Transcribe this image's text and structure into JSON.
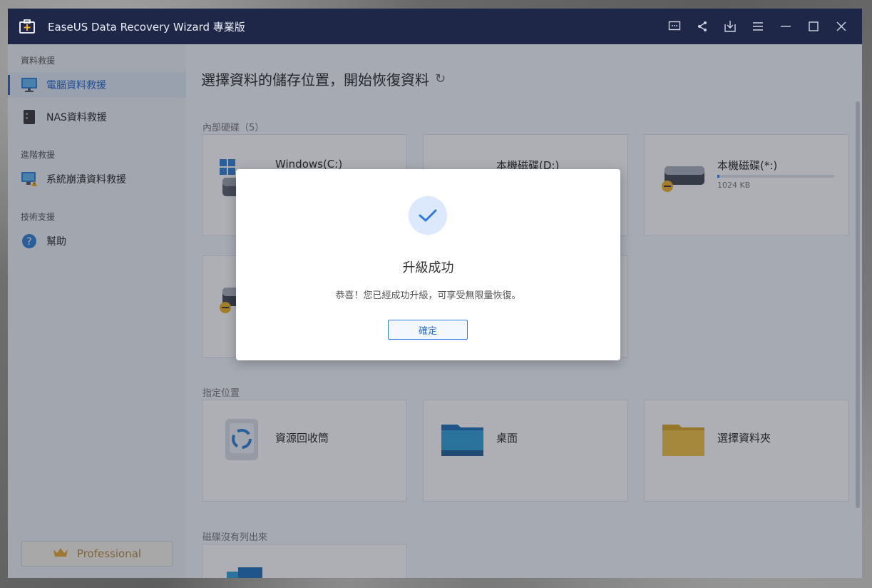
{
  "app": {
    "title": "EaseUS Data Recovery Wizard 專業版"
  },
  "sidebar": {
    "sections": [
      {
        "label": "資料救援"
      },
      {
        "label": "進階救援"
      },
      {
        "label": "技術支援"
      }
    ],
    "items": [
      {
        "label": "電腦資料救援",
        "icon": "monitor-icon",
        "active": true
      },
      {
        "label": "NAS資料救援",
        "icon": "nas-icon"
      },
      {
        "label": "系統崩潰資料救援",
        "icon": "system-crash-icon"
      },
      {
        "label": "幫助",
        "icon": "help-icon"
      }
    ],
    "pro_label": "Professional"
  },
  "main": {
    "title": "選擇資料的儲存位置，開始恢復資料",
    "internal_label": "內部硬碟（5）",
    "drives": [
      {
        "name": "Windows(C:)"
      },
      {
        "name": "本機磁碟(D:)"
      },
      {
        "name": "本機磁碟(*:)",
        "size": "1024 KB",
        "used_fraction": 0.02
      }
    ],
    "locations_label": "指定位置",
    "locations": [
      {
        "name": "資源回收筒",
        "icon": "recycle-bin-icon"
      },
      {
        "name": "桌面",
        "icon": "desktop-folder-icon"
      },
      {
        "name": "選擇資料夾",
        "icon": "folder-icon"
      }
    ],
    "unlisted_label": "磁碟沒有列出來"
  },
  "dialog": {
    "title": "升級成功",
    "message": "恭喜！您已經成功升級，可享受無限量恢復。",
    "ok_label": "確定"
  },
  "colors": {
    "accent": "#2d7be0",
    "titlebar": "#1f2749"
  }
}
